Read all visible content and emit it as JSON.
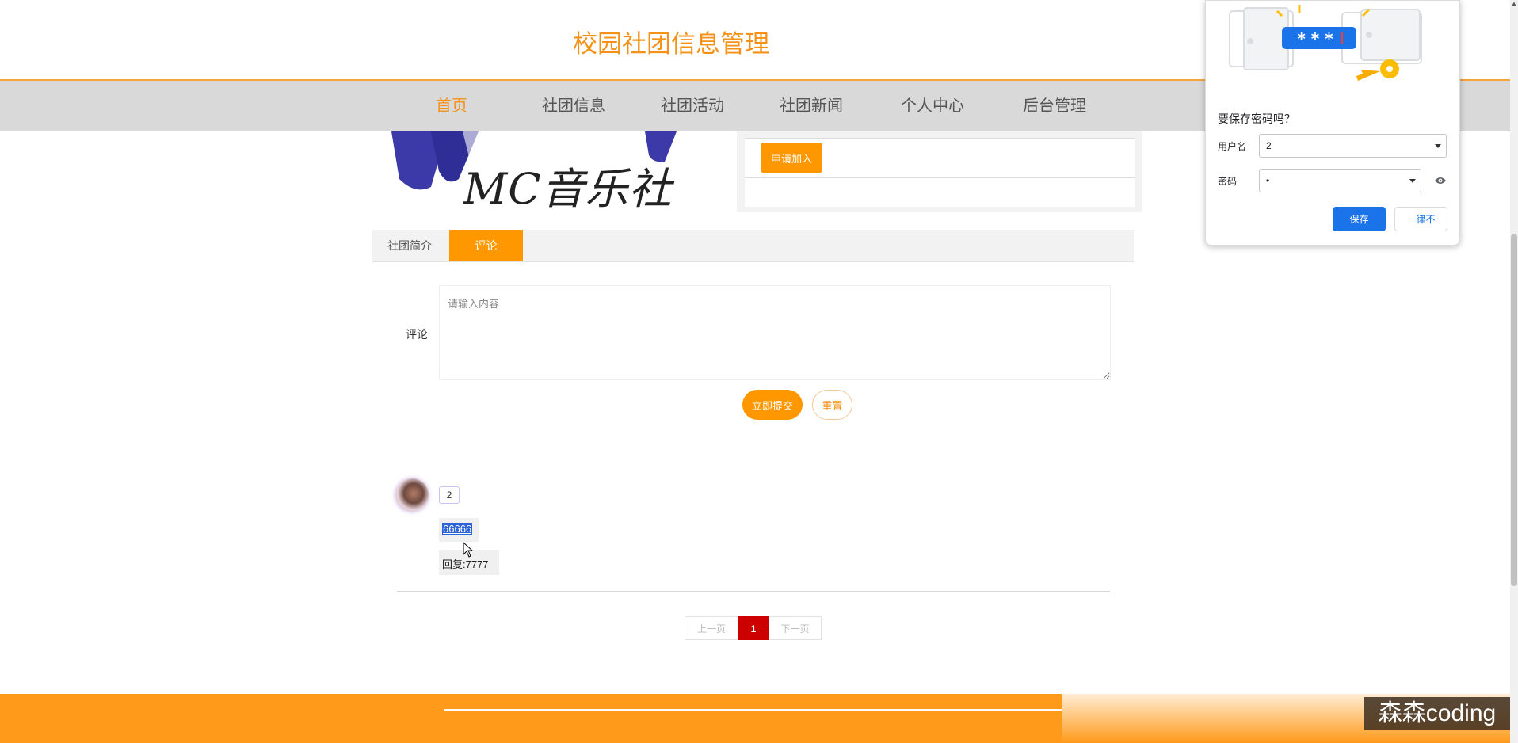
{
  "header": {
    "title": "校园社团信息管理"
  },
  "nav": {
    "items": [
      {
        "label": "首页",
        "active": true
      },
      {
        "label": "社团信息",
        "active": false
      },
      {
        "label": "社团活动",
        "active": false
      },
      {
        "label": "社团新闻",
        "active": false
      },
      {
        "label": "个人中心",
        "active": false
      },
      {
        "label": "后台管理",
        "active": false
      }
    ]
  },
  "club": {
    "logo_text": "MC音乐社",
    "apply_label": "申请加入"
  },
  "tabs": [
    {
      "label": "社团简介",
      "active": false
    },
    {
      "label": "评论",
      "active": true
    }
  ],
  "comment_form": {
    "label": "评论",
    "placeholder": "请输入内容",
    "submit_label": "立即提交",
    "reset_label": "重置"
  },
  "comments": [
    {
      "user": "2",
      "text": "66666",
      "reply": "回复:7777"
    }
  ],
  "pagination": {
    "prev_label": "上一页",
    "current_page": "1",
    "next_label": "下一页"
  },
  "password_prompt": {
    "title": "要保存密码吗？",
    "username_label": "用户名",
    "username_value": "2",
    "password_label": "密码",
    "password_value": "•",
    "mask_text": "* * *",
    "save_label": "保存",
    "never_label": "一律不"
  },
  "watermark": {
    "text": "森森coding"
  },
  "colors": {
    "accent": "#ff9800",
    "title": "#f39217",
    "page_active": "#cc0000",
    "chrome_blue": "#1a73e8"
  }
}
